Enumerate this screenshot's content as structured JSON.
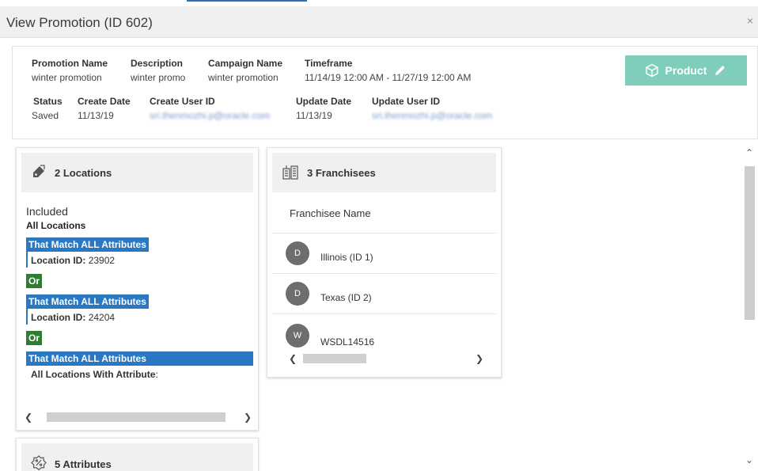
{
  "modal": {
    "title": "View Promotion (ID 602)",
    "close_label": "×"
  },
  "summary": {
    "promotion_name": {
      "label": "Promotion Name",
      "value": "winter promotion"
    },
    "description": {
      "label": "Description",
      "value": "winter promo"
    },
    "campaign_name": {
      "label": "Campaign Name",
      "value": "winter promotion"
    },
    "timeframe": {
      "label": "Timeframe",
      "value": "11/14/19 12:00 AM - 11/27/19 12:00 AM"
    },
    "status": {
      "label": "Status",
      "value": "Saved"
    },
    "create_date": {
      "label": "Create Date",
      "value": "11/13/19"
    },
    "create_user_id": {
      "label": "Create User ID",
      "value": "sri.thenmozhi.p@oracle.com"
    },
    "update_date": {
      "label": "Update Date",
      "value": "11/13/19"
    },
    "update_user_id": {
      "label": "Update User ID",
      "value": "sri.thenmozhi.p@oracle.com"
    }
  },
  "product_button": {
    "label": "Product",
    "icon": "cube-icon",
    "edit_icon": "pencil-icon",
    "color": "#7fcdbb"
  },
  "locations_card": {
    "title": "2 Locations",
    "icon": "tag-icon",
    "included_label": "Included",
    "all_locations_label": "All Locations",
    "groups": [
      {
        "header": "That Match ALL Attributes",
        "field_label": "Location ID",
        "field_value": "23902"
      },
      {
        "header": "That Match ALL Attributes",
        "field_label": "Location ID",
        "field_value": "24204"
      },
      {
        "header": "That Match ALL Attributes",
        "field_label": "All Locations With Attribute",
        "field_value": ""
      }
    ],
    "or_label": "Or"
  },
  "franchisees_card": {
    "title": "3 Franchisees",
    "icon": "buildings-icon",
    "column_header": "Franchisee Name",
    "rows": [
      {
        "initial": "D",
        "name": "Illinois (ID 1)"
      },
      {
        "initial": "D",
        "name": "Texas (ID 2)"
      },
      {
        "initial": "W",
        "name": "WSDL14516"
      }
    ]
  },
  "attributes_card": {
    "title": "5 Attributes",
    "icon": "badge-percent-icon"
  },
  "colors": {
    "accent_blue": "#2a78c2",
    "or_green": "#2e7d32",
    "header_gray": "#f0f0f0"
  }
}
